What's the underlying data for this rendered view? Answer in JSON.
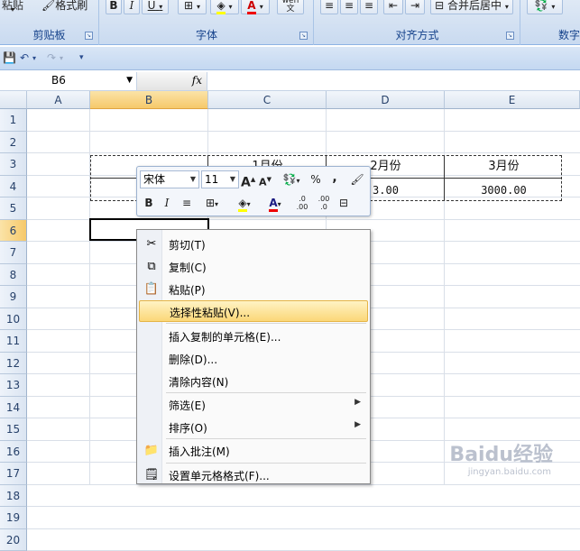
{
  "ribbon": {
    "groups": [
      {
        "label": "剪贴板"
      },
      {
        "label": "字体"
      },
      {
        "label": "对齐方式"
      },
      {
        "label": "数字"
      }
    ],
    "clipboard": {
      "paste_label": "粘贴",
      "format_painter": "格式刷"
    },
    "font": {
      "bold": "B",
      "italic": "I",
      "underline": "U",
      "font_color": "A",
      "wen": "wén 文"
    },
    "align": {
      "merge_center": "合并后居中"
    }
  },
  "formula_bar": {
    "name_box": "B6",
    "fx_label": "fx",
    "value": ""
  },
  "sheet": {
    "columns": [
      "A",
      "B",
      "C",
      "D",
      "E"
    ],
    "selected_column": "B",
    "rows": [
      "1",
      "2",
      "3",
      "4",
      "5",
      "6",
      "7",
      "8",
      "9",
      "10",
      "11",
      "12",
      "13",
      "14",
      "15",
      "16",
      "17",
      "18",
      "19",
      "20"
    ],
    "selected_row": "6",
    "cells": {
      "C3": "1月份",
      "D3": "2月份",
      "E3": "3月份",
      "D4": "3.00",
      "E4": "3000.00"
    }
  },
  "mini_toolbar": {
    "font_name": "宋体",
    "font_size": "11",
    "grow": "A",
    "shrink": "A",
    "percent": "%",
    "comma": ",",
    "bold": "B",
    "italic": "I",
    "font_color_label": "A",
    "increase_decimal": ".0 .00",
    "decrease_decimal": ".00 .0"
  },
  "context_menu": {
    "items": [
      {
        "label": "剪切(T)",
        "icon": "scissors-icon"
      },
      {
        "label": "复制(C)",
        "icon": "copy-icon"
      },
      {
        "label": "粘贴(P)",
        "icon": "paste-icon"
      },
      {
        "label": "选择性粘贴(V)...",
        "highlighted": true
      },
      {
        "label": "插入复制的单元格(E)..."
      },
      {
        "label": "删除(D)..."
      },
      {
        "label": "清除内容(N)"
      },
      {
        "label": "筛选(E)",
        "submenu": true
      },
      {
        "label": "排序(O)",
        "submenu": true
      },
      {
        "label": "插入批注(M)",
        "icon": "comment-icon"
      },
      {
        "label": "设置单元格格式(F)...",
        "icon": "format-cells-icon"
      }
    ]
  },
  "watermark": {
    "brand": "Baidu经验",
    "url": "jingyan.baidu.com"
  },
  "colors": {
    "highlight": "#fbd778",
    "selected_header": "#f6c96a",
    "ribbon_text": "#15428b"
  }
}
